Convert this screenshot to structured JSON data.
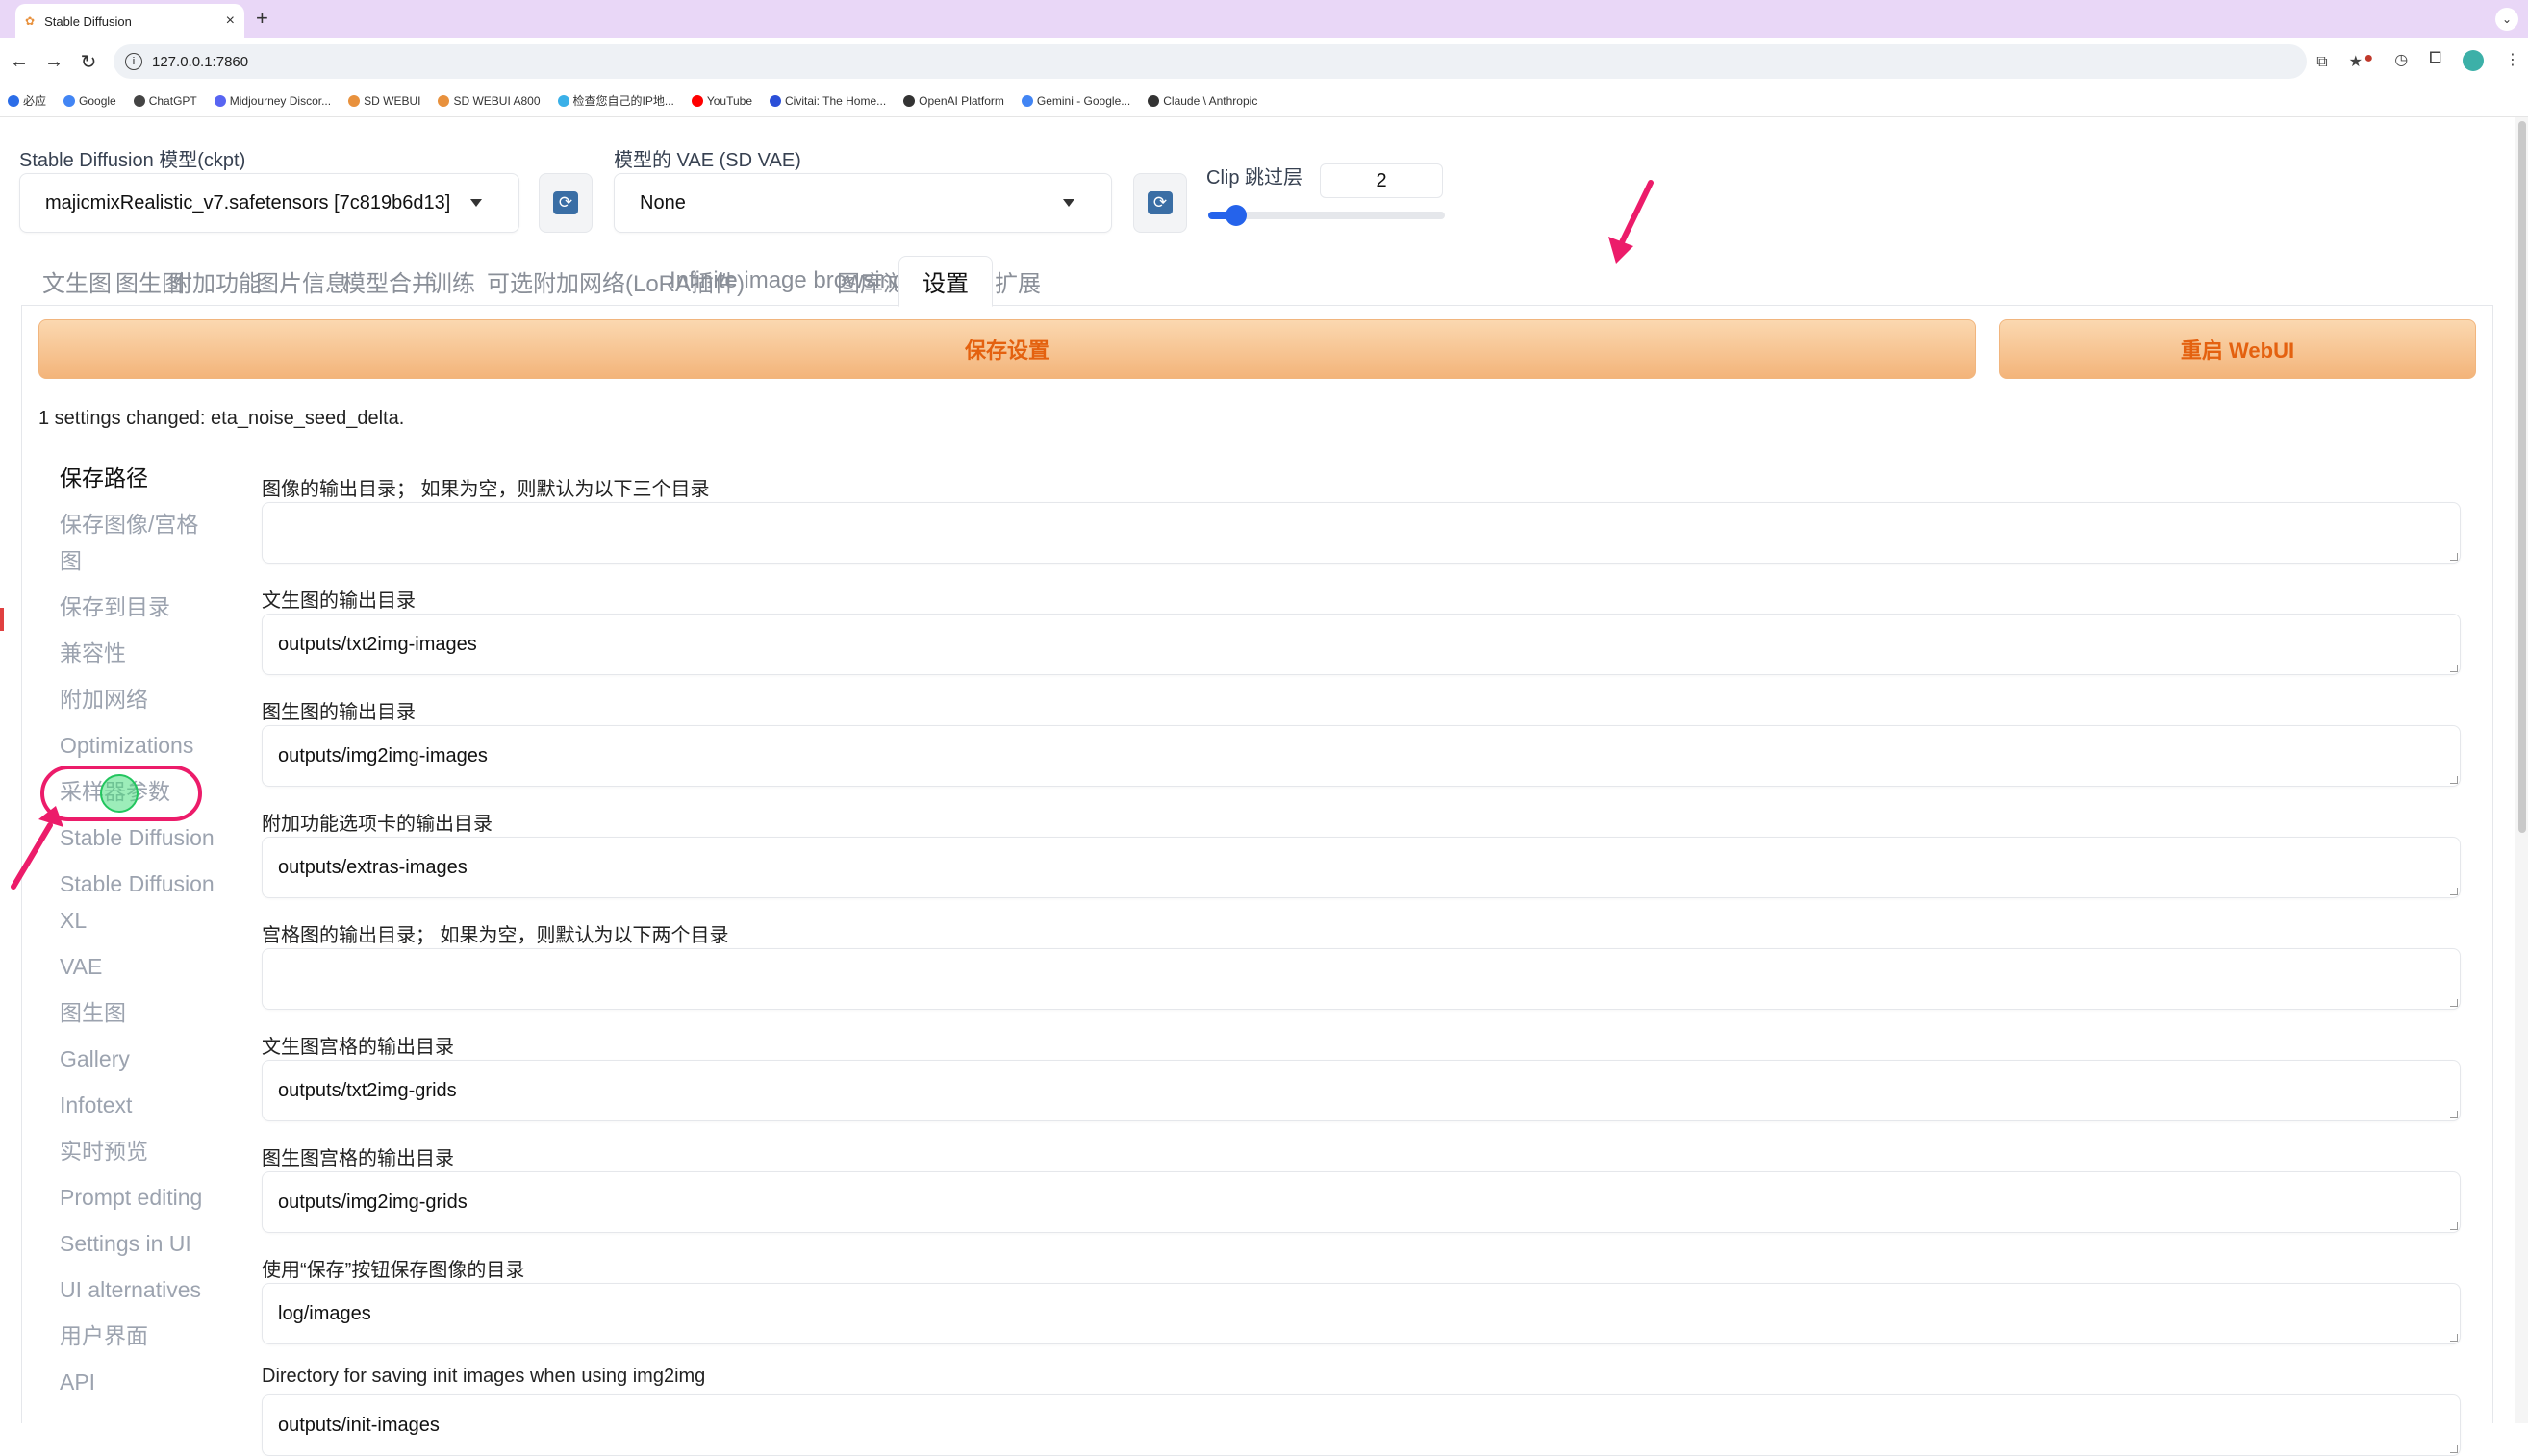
{
  "browser": {
    "tab_title": "Stable Diffusion",
    "tab_close": "×",
    "new_tab": "+",
    "tabs_menu": "⌄",
    "url": "127.0.0.1:7860",
    "nav": {
      "back": "←",
      "forward": "→",
      "reload": "↻"
    },
    "bookmarks": [
      "必应",
      "Google",
      "ChatGPT",
      "Midjourney Discor...",
      "SD WEBUI",
      "SD WEBUI A800",
      "检查您自己的IP地...",
      "YouTube",
      "Civitai: The Home...",
      "OpenAI Platform",
      "Gemini - Google...",
      "Claude \\ Anthropic"
    ],
    "bookmark_colors": [
      "#2b6de8",
      "#4285f4",
      "#444444",
      "#5865f2",
      "#e8913d",
      "#e8913d",
      "#3ab0e8",
      "#ff0000",
      "#2b4fd8",
      "#333333",
      "#4285f4",
      "#333333"
    ]
  },
  "header": {
    "ckpt_label": "Stable Diffusion 模型(ckpt)",
    "ckpt_value": "majicmixRealistic_v7.safetensors [7c819b6d13]",
    "vae_label": "模型的 VAE (SD VAE)",
    "vae_value": "None",
    "clip_label": "Clip 跳过层",
    "clip_value": "2",
    "clip_min": 1,
    "clip_max": 12
  },
  "tabs": [
    "文生图",
    "图生图",
    "附加功能",
    "图片信息",
    "模型合并",
    "训练",
    "可选附加网络(LoRA插件)",
    "Infinite image browsing",
    "图库浏览器",
    "设置",
    "扩展"
  ],
  "active_tab": "设置",
  "actions": {
    "save": "保存设置",
    "restart": "重启 WebUI"
  },
  "status": "1 settings changed: eta_noise_seed_delta.",
  "sidebar": {
    "items": [
      "保存路径",
      "保存图像/宫格",
      "图",
      "保存到目录",
      "兼容性",
      "附加网络",
      "Optimizations",
      "采样器参数",
      "Stable Diffusion",
      "Stable Diffusion",
      "XL",
      "VAE",
      "图生图",
      "Gallery",
      "Infotext",
      "实时预览",
      "Prompt editing",
      "Settings in UI",
      "UI alternatives",
      "用户界面",
      "API"
    ],
    "active": "保存路径"
  },
  "fields": [
    {
      "label": "图像的输出目录； 如果为空，则默认为以下三个目录",
      "value": ""
    },
    {
      "label": "文生图的输出目录",
      "value": "outputs/txt2img-images"
    },
    {
      "label": "图生图的输出目录",
      "value": "outputs/img2img-images"
    },
    {
      "label": "附加功能选项卡的输出目录",
      "value": "outputs/extras-images"
    },
    {
      "label": "宫格图的输出目录； 如果为空，则默认为以下两个目录",
      "value": ""
    },
    {
      "label": "文生图宫格的输出目录",
      "value": "outputs/txt2img-grids"
    },
    {
      "label": "图生图宫格的输出目录",
      "value": "outputs/img2img-grids"
    },
    {
      "label": "使用“保存”按钮保存图像的目录",
      "value": "log/images"
    },
    {
      "label": "Directory for saving init images when using img2img",
      "value": "outputs/init-images"
    }
  ],
  "colors": {
    "accent": "#e4610f",
    "annotation": "#ec1c6a",
    "slider": "#2563eb"
  }
}
